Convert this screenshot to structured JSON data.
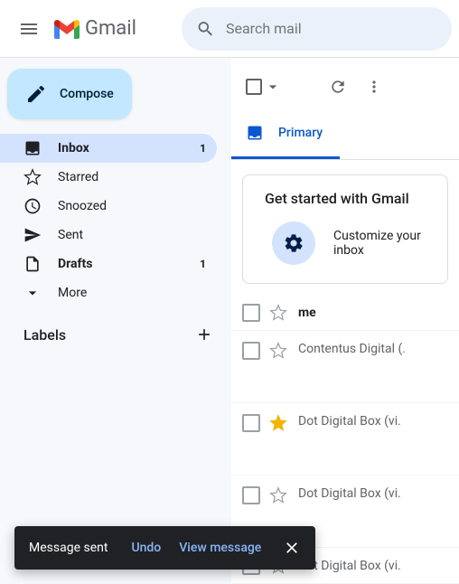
{
  "header": {
    "app_name": "Gmail",
    "search_placeholder": "Search mail"
  },
  "compose_label": "Compose",
  "nav": [
    {
      "label": "Inbox",
      "count": "1",
      "active": true,
      "bold": true,
      "icon": "inbox"
    },
    {
      "label": "Starred",
      "count": "",
      "active": false,
      "bold": false,
      "icon": "star"
    },
    {
      "label": "Snoozed",
      "count": "",
      "active": false,
      "bold": false,
      "icon": "clock"
    },
    {
      "label": "Sent",
      "count": "",
      "active": false,
      "bold": false,
      "icon": "send"
    },
    {
      "label": "Drafts",
      "count": "1",
      "active": false,
      "bold": true,
      "icon": "file"
    },
    {
      "label": "More",
      "count": "",
      "active": false,
      "bold": false,
      "icon": "chevron"
    }
  ],
  "labels_header": "Labels",
  "tabs": {
    "primary": "Primary"
  },
  "promo": {
    "title": "Get started with Gmail",
    "action": "Customize your inbox"
  },
  "mails": [
    {
      "sender": "me",
      "starred": false,
      "read": false,
      "tall": false
    },
    {
      "sender": "Contentus Digital (.",
      "starred": false,
      "read": true,
      "tall": true
    },
    {
      "sender": "Dot Digital Box (vi.",
      "starred": true,
      "read": true,
      "tall": true
    },
    {
      "sender": "Dot Digital Box (vi.",
      "starred": false,
      "read": true,
      "tall": true
    },
    {
      "sender": "Dot Digital Box (vi.",
      "starred": false,
      "read": true,
      "tall": false
    }
  ],
  "toast": {
    "message": "Message sent",
    "undo": "Undo",
    "view": "View message"
  }
}
